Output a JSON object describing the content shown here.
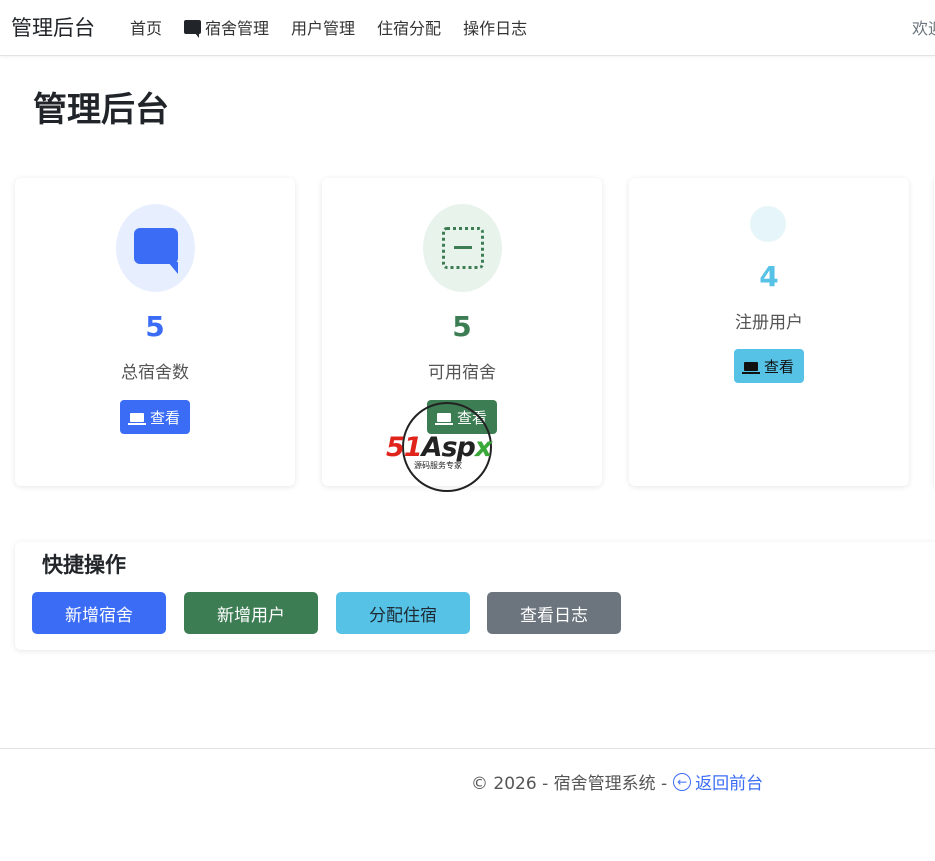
{
  "navbar": {
    "brand": "管理后台",
    "items": [
      {
        "label": "首页",
        "icon": ""
      },
      {
        "label": "宿舍管理",
        "icon": "chat-icon"
      },
      {
        "label": "用户管理",
        "icon": ""
      },
      {
        "label": "住宿分配",
        "icon": ""
      },
      {
        "label": "操作日志",
        "icon": ""
      }
    ],
    "welcome": "欢迎"
  },
  "page": {
    "title": "管理后台"
  },
  "stats": [
    {
      "value": "5",
      "label": "总宿舍数",
      "button": "查看",
      "icon": "chat-icon",
      "color": "#3b6cf6"
    },
    {
      "value": "5",
      "label": "可用宿舍",
      "button": "查看",
      "icon": "dotted-square-icon",
      "color": "#3c7d54"
    },
    {
      "value": "4",
      "label": "注册用户",
      "button": "查看",
      "icon": "users-icon",
      "color": "#55c2e6"
    }
  ],
  "watermark": {
    "brand_red": "51",
    "brand_dark": "Asp",
    "brand_green": "x",
    "subtitle": "源码服务专家"
  },
  "quick_actions": {
    "title": "快捷操作",
    "buttons": [
      "新增宿舍",
      "新增用户",
      "分配住宿",
      "查看日志"
    ]
  },
  "footer": {
    "copyright": "© 2026 - 宿舍管理系统 -",
    "back_link": "返回前台"
  }
}
